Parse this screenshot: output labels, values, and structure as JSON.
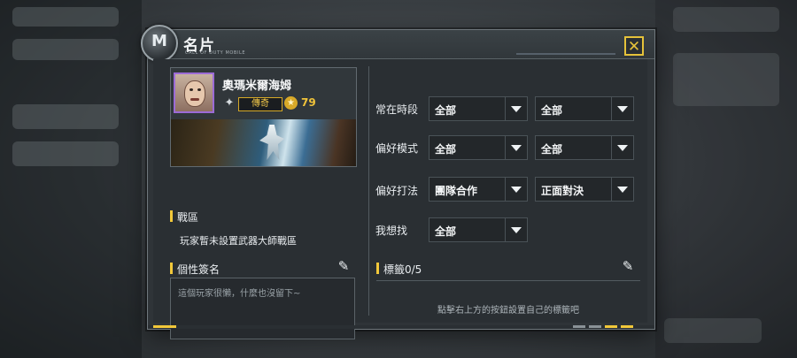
{
  "window": {
    "title": "名片",
    "subtitle": "CALL OF DUTY MOBILE",
    "close_symbol": "✕"
  },
  "profile": {
    "name": "奧瑪米爾海姆",
    "rank_label": "傳奇",
    "level": "79"
  },
  "zone": {
    "heading": "戰區",
    "text": "玩家暫未設置武器大師戰區"
  },
  "signature": {
    "heading": "個性簽名",
    "text": "這個玩家很懶，什麼也沒留下~"
  },
  "preferences": [
    {
      "label": "常在時段",
      "values": [
        "全部",
        "全部"
      ]
    },
    {
      "label": "偏好模式",
      "values": [
        "全部",
        "全部"
      ]
    },
    {
      "label": "偏好打法",
      "values": [
        "團隊合作",
        "正面對決"
      ]
    },
    {
      "label": "我想找",
      "values": [
        "全部"
      ]
    }
  ],
  "tags": {
    "heading": "標籤0/5",
    "hint": "點擊右上方的按鈕設置自己的標籤吧"
  },
  "colors": {
    "accent": "#f2c83a",
    "legendary_border": "#d6a927",
    "avatar_frame": "#9c6bd6"
  },
  "icons": {
    "close": "close-icon",
    "edit": "pencil-icon",
    "dropdown": "chevron-down-icon",
    "rank": "rank-emblem-icon",
    "level": "star-icon"
  }
}
